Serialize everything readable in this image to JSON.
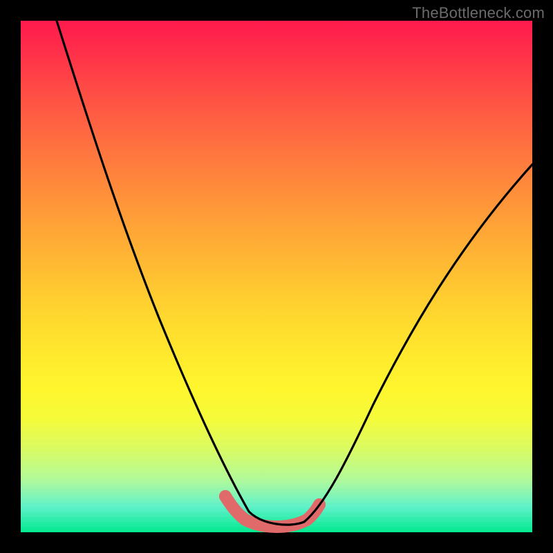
{
  "watermark": "TheBottleneck.com",
  "chart_data": {
    "type": "line",
    "title": "",
    "xlabel": "",
    "ylabel": "",
    "xlim": [
      0,
      100
    ],
    "ylim": [
      0,
      100
    ],
    "series": [
      {
        "name": "bottleneck-curve",
        "x": [
          7,
          10,
          15,
          20,
          25,
          30,
          35,
          38,
          40,
          42,
          44,
          46,
          48,
          50,
          52,
          54,
          56,
          58,
          62,
          68,
          75,
          82,
          90,
          100
        ],
        "y": [
          100,
          92,
          80,
          68,
          55,
          42,
          28,
          18,
          12,
          7,
          4,
          2,
          1.2,
          1,
          1,
          1.2,
          2,
          4,
          10,
          20,
          33,
          46,
          58,
          72
        ]
      },
      {
        "name": "bottom-marker-band",
        "x": [
          40,
          42,
          44,
          46,
          48,
          50,
          52,
          54,
          56,
          58
        ],
        "y": [
          7,
          4,
          2,
          1.2,
          1,
          1,
          1,
          1.2,
          2,
          4
        ]
      }
    ],
    "colors": {
      "curve": "#000000",
      "marker": "#e06a6a"
    }
  }
}
